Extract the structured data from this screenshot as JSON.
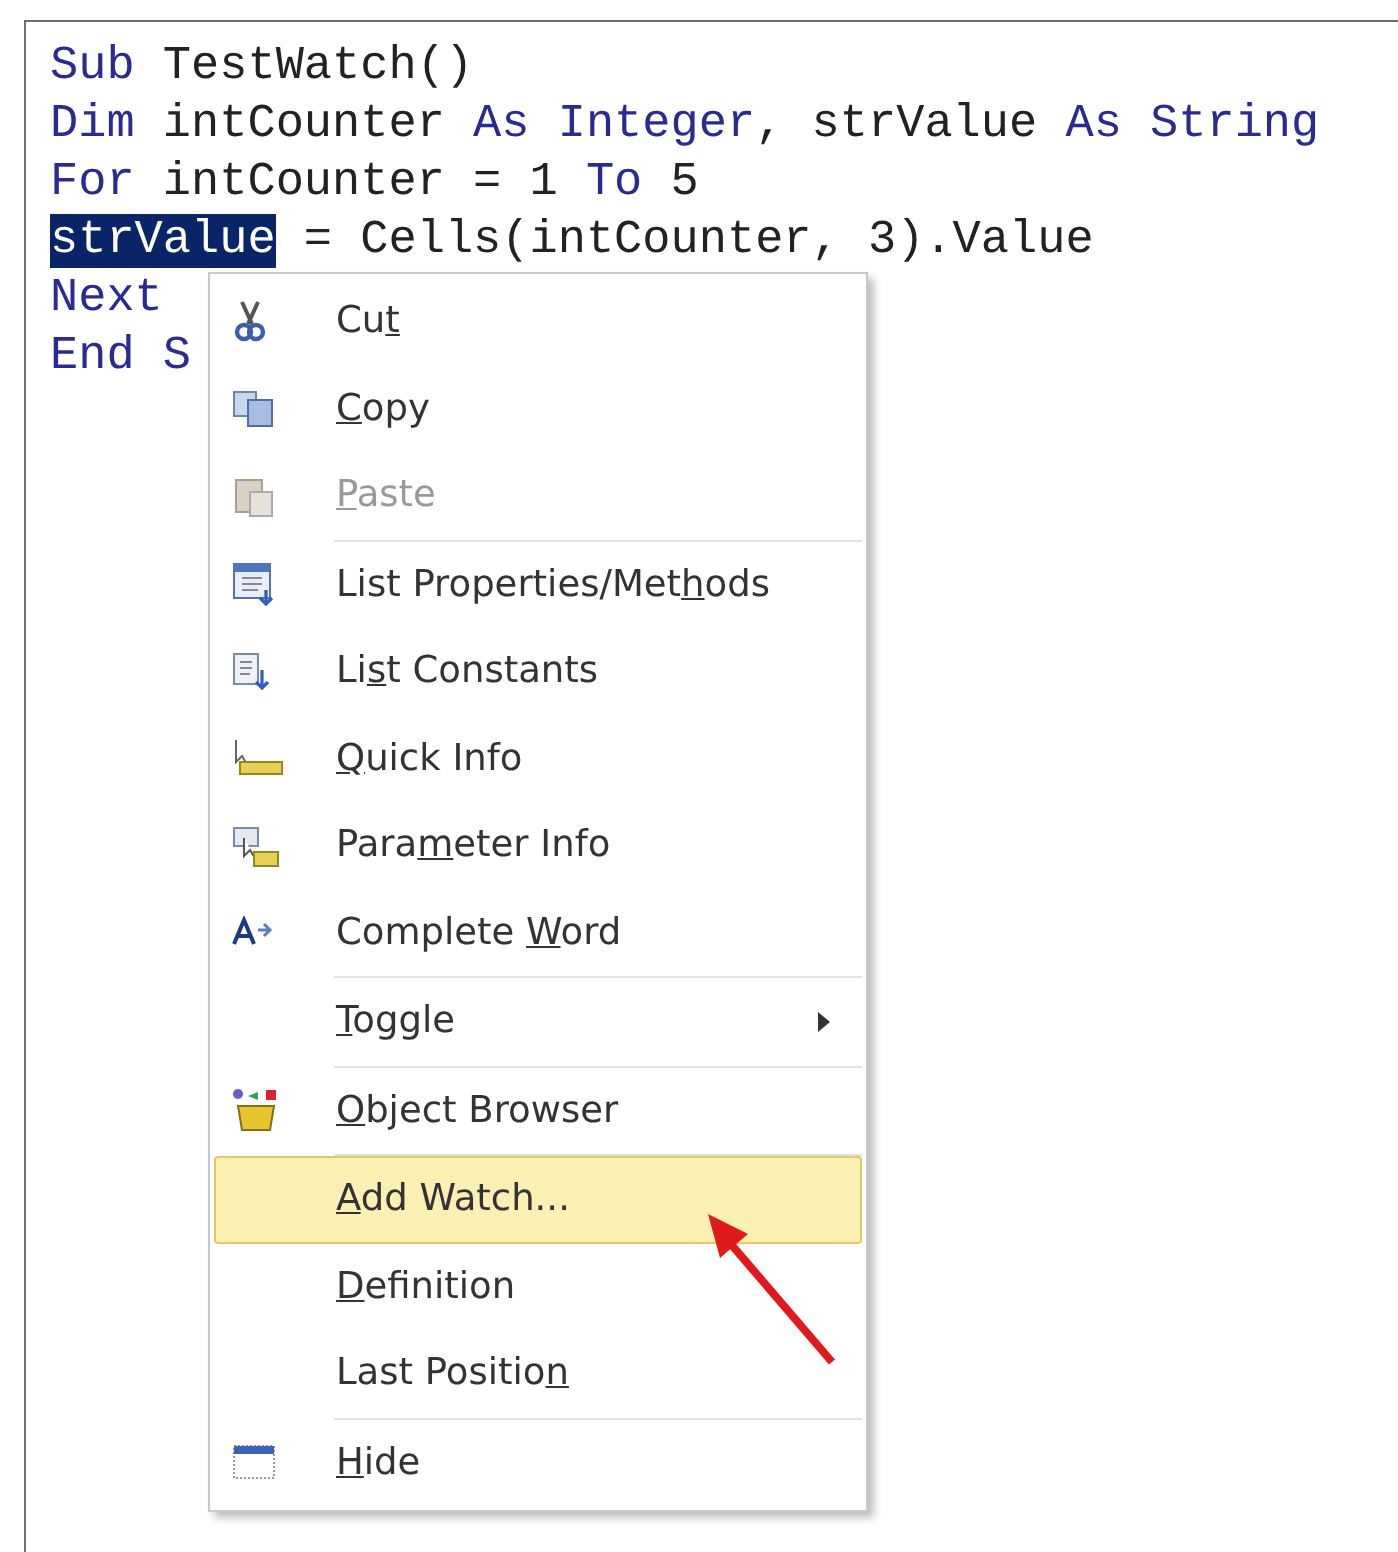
{
  "code_lines": [
    [
      {
        "kind": "keyword",
        "text": "Sub"
      },
      {
        "kind": "code",
        "text": " TestWatch()"
      }
    ],
    [
      {
        "kind": "keyword",
        "text": "Dim"
      },
      {
        "kind": "code",
        "text": " intCounter "
      },
      {
        "kind": "keyword",
        "text": "As Integer"
      },
      {
        "kind": "code",
        "text": ", strValue "
      },
      {
        "kind": "keyword",
        "text": "As String"
      }
    ],
    [
      {
        "kind": "keyword",
        "text": "For"
      },
      {
        "kind": "code",
        "text": " intCounter = 1 "
      },
      {
        "kind": "keyword",
        "text": "To"
      },
      {
        "kind": "code",
        "text": " 5"
      }
    ],
    [
      {
        "kind": "selection",
        "text": "strValue"
      },
      {
        "kind": "code",
        "text": " = Cells(intCounter, 3).Value"
      }
    ],
    [
      {
        "kind": "keyword",
        "text": "Next"
      }
    ],
    [
      {
        "kind": "keyword",
        "text": "End S"
      }
    ]
  ],
  "context_menu": [
    {
      "kind": "item",
      "before": "Cu",
      "key": "t",
      "disabled": false,
      "selected": false,
      "submenu": false
    },
    {
      "kind": "item",
      "key": "C",
      "after": "opy",
      "disabled": false,
      "selected": false,
      "submenu": false
    },
    {
      "kind": "item",
      "key": "P",
      "after": "aste",
      "disabled": true,
      "selected": false,
      "submenu": false
    },
    {
      "kind": "separator"
    },
    {
      "kind": "item",
      "before": "List Properties/Met",
      "key": "h",
      "after": "ods",
      "disabled": false,
      "selected": false,
      "submenu": false
    },
    {
      "kind": "item",
      "before": "Li",
      "key": "s",
      "after": "t Constants",
      "disabled": false,
      "selected": false,
      "submenu": false
    },
    {
      "kind": "item",
      "key": "Q",
      "after": "uick Info",
      "disabled": false,
      "selected": false,
      "submenu": false
    },
    {
      "kind": "item",
      "before": "Para",
      "key": "m",
      "after": "eter Info",
      "disabled": false,
      "selected": false,
      "submenu": false
    },
    {
      "kind": "item",
      "before": "Complete ",
      "key": "W",
      "after": "ord",
      "disabled": false,
      "selected": false,
      "submenu": false
    },
    {
      "kind": "separator"
    },
    {
      "kind": "item",
      "key": "T",
      "after": "oggle",
      "disabled": false,
      "selected": false,
      "submenu": true
    },
    {
      "kind": "separator"
    },
    {
      "kind": "item",
      "key": "O",
      "after": "bject Browser",
      "disabled": false,
      "selected": false,
      "submenu": false
    },
    {
      "kind": "separator"
    },
    {
      "kind": "item",
      "key": "A",
      "after": "dd Watch...",
      "disabled": false,
      "selected": true,
      "submenu": false
    },
    {
      "kind": "item",
      "key": "D",
      "after": "efinition",
      "disabled": false,
      "selected": false,
      "submenu": false
    },
    {
      "kind": "item",
      "before": "Last Positio",
      "key": "n",
      "disabled": false,
      "selected": false,
      "submenu": false
    },
    {
      "kind": "separator"
    },
    {
      "kind": "item",
      "key": "H",
      "after": "ide",
      "disabled": false,
      "selected": false,
      "submenu": false
    }
  ]
}
